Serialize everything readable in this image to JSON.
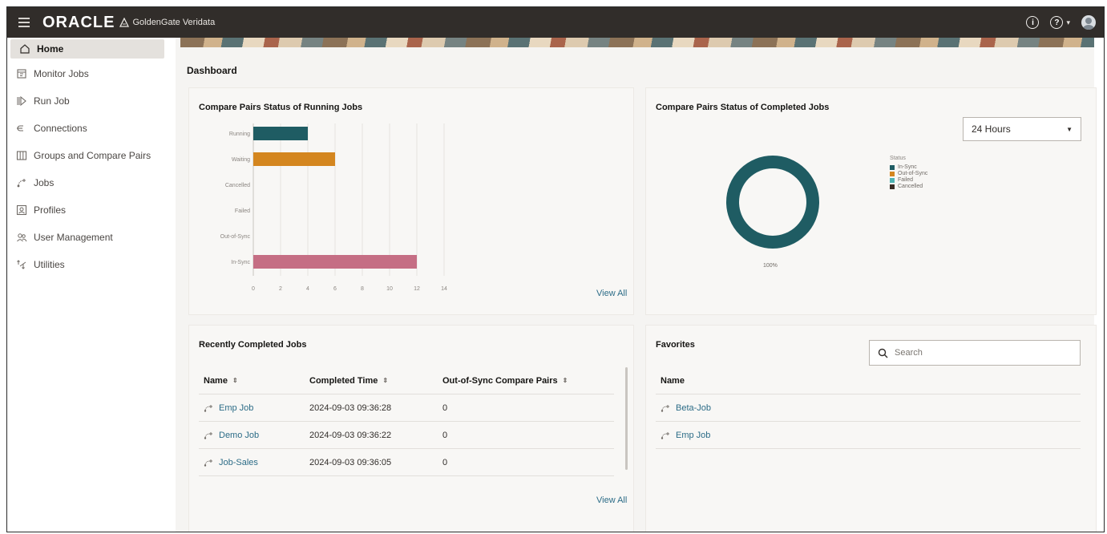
{
  "topbar": {
    "brand": "ORACLE",
    "product": "GoldenGate Veridata"
  },
  "sidebar": {
    "items": [
      {
        "label": "Home",
        "icon": "home-icon"
      },
      {
        "label": "Monitor Jobs",
        "icon": "monitor-icon"
      },
      {
        "label": "Run Job",
        "icon": "run-icon"
      },
      {
        "label": "Connections",
        "icon": "connections-icon"
      },
      {
        "label": "Groups and Compare Pairs",
        "icon": "table-icon"
      },
      {
        "label": "Jobs",
        "icon": "jobs-icon"
      },
      {
        "label": "Profiles",
        "icon": "profile-icon"
      },
      {
        "label": "User Management",
        "icon": "users-icon"
      },
      {
        "label": "Utilities",
        "icon": "utilities-icon"
      }
    ]
  },
  "main": {
    "title": "Dashboard"
  },
  "running_card": {
    "title": "Compare Pairs Status of Running Jobs",
    "view_all": "View All"
  },
  "completed_card": {
    "title": "Compare Pairs Status of Completed Jobs",
    "range": "24 Hours",
    "legend_title": "Status",
    "legend": [
      "In-Sync",
      "Out-of-Sync",
      "Failed",
      "Cancelled"
    ],
    "donut_label": "100%"
  },
  "recent_card": {
    "title": "Recently Completed Jobs",
    "columns": [
      "Name",
      "Completed Time",
      "Out-of-Sync Compare Pairs"
    ],
    "rows": [
      [
        "Emp Job",
        "2024-09-03 09:36:28",
        "0"
      ],
      [
        "Demo Job",
        "2024-09-03 09:36:22",
        "0"
      ],
      [
        "Job-Sales",
        "2024-09-03 09:36:05",
        "0"
      ]
    ],
    "view_all": "View All"
  },
  "favorites_card": {
    "title": "Favorites",
    "search_placeholder": "Search",
    "column": "Name",
    "rows": [
      "Beta-Job",
      "Emp Job"
    ]
  },
  "colors": {
    "in_sync": "#1f5c63",
    "out_of_sync": "#d4861f",
    "failed": "#4fb3b3",
    "cancelled": "#3a2d25",
    "in_sync_bar": "#c56e84",
    "link": "#2c6c87"
  },
  "chart_data": [
    {
      "type": "bar",
      "orientation": "horizontal",
      "categories": [
        "Running",
        "Waiting",
        "Cancelled",
        "Failed",
        "Out-of-Sync",
        "In-Sync"
      ],
      "values": [
        4,
        6,
        0,
        0,
        0,
        12
      ],
      "colors": [
        "#1f5c63",
        "#d4861f",
        "#8a8580",
        "#8a8580",
        "#8a8580",
        "#c56e84"
      ],
      "xticks": [
        "0",
        "2",
        "4",
        "6",
        "8",
        "10",
        "12",
        "14"
      ],
      "xlim": [
        0,
        14
      ],
      "grid": true
    },
    {
      "type": "pie",
      "style": "donut",
      "categories": [
        "In-Sync",
        "Out-of-Sync",
        "Failed",
        "Cancelled"
      ],
      "values": [
        100,
        0,
        0,
        0
      ],
      "legend_position": "right"
    }
  ]
}
